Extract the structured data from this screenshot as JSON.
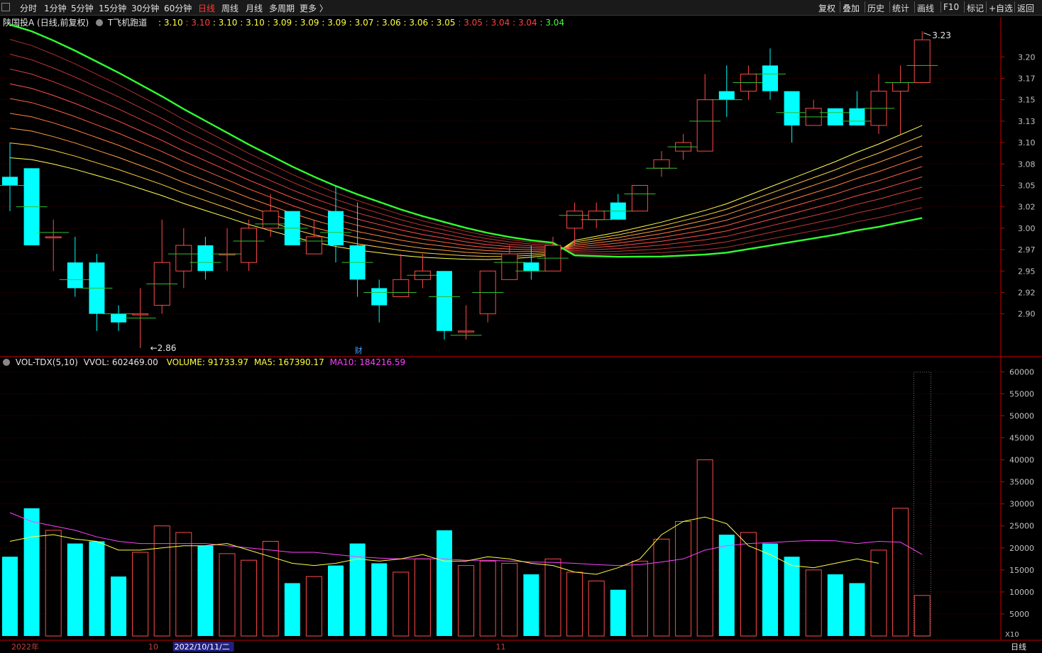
{
  "toolbar": {
    "left": [
      "分时",
      "1分钟",
      "5分钟",
      "15分钟",
      "30分钟",
      "60分钟",
      "日线",
      "周线",
      "月线",
      "多周期",
      "更多 〉"
    ],
    "active": "日线",
    "right": [
      "复权",
      "叠加",
      "历史",
      "统计",
      "画线",
      "F10",
      "标记",
      "+自选",
      "返回"
    ]
  },
  "main_info": {
    "stock": "陕国投A (日线,前复权)",
    "indicator": "T飞机跑道",
    "values": [
      {
        "v": "3.10",
        "c": "#ffff40"
      },
      {
        "v": "3.10",
        "c": "#ff4040"
      },
      {
        "v": "3.10",
        "c": "#ffff40"
      },
      {
        "v": "3.10",
        "c": "#ffff40"
      },
      {
        "v": "3.09",
        "c": "#ffff40"
      },
      {
        "v": "3.09",
        "c": "#ffff40"
      },
      {
        "v": "3.09",
        "c": "#ffff40"
      },
      {
        "v": "3.07",
        "c": "#ffff40"
      },
      {
        "v": "3.06",
        "c": "#ffff40"
      },
      {
        "v": "3.06",
        "c": "#ffff40"
      },
      {
        "v": "3.05",
        "c": "#ffff40"
      },
      {
        "v": "3.05",
        "c": "#ff4040"
      },
      {
        "v": "3.04",
        "c": "#ff4040"
      },
      {
        "v": "3.04",
        "c": "#ff4040"
      },
      {
        "v": "3.04",
        "c": "#40ff40"
      }
    ]
  },
  "vol_info": {
    "name": "VOL-TDX(5,10)",
    "vvol": "VVOL: 602469.00",
    "volume": "VOLUME: 91733.97",
    "ma5": "MA5: 167390.17",
    "ma10": "MA10: 184216.59"
  },
  "colors": {
    "up": "#ff4a4a",
    "down": "#00ffff",
    "ma5": "#ffff40",
    "ma10": "#ff40ff",
    "grid": "#5a0000",
    "axis": "#c80000"
  },
  "chart_data": {
    "type": "candlestick",
    "price_ticks": [
      "3.20",
      "3.17",
      "3.15",
      "3.13",
      "3.10",
      "3.08",
      "3.05",
      "3.02",
      "3.00",
      "2.97",
      "2.95",
      "2.92",
      "2.90"
    ],
    "price_tick_values": [
      3.2,
      3.175,
      3.15,
      3.125,
      3.1,
      3.075,
      3.05,
      3.025,
      3.0,
      2.975,
      2.95,
      2.925,
      2.9
    ],
    "price_range": [
      2.855,
      3.235
    ],
    "high_label": "3.23",
    "low_label": "2.86",
    "event_marker": "财",
    "candles": [
      {
        "o": 3.06,
        "c": 3.05,
        "h": 3.1,
        "l": 3.02
      },
      {
        "o": 3.07,
        "c": 2.98,
        "h": 3.07,
        "l": 2.98
      },
      {
        "o": 2.99,
        "c": 2.99,
        "h": 3.01,
        "l": 2.95
      },
      {
        "o": 2.96,
        "c": 2.93,
        "h": 2.99,
        "l": 2.92
      },
      {
        "o": 2.96,
        "c": 2.9,
        "h": 2.97,
        "l": 2.88
      },
      {
        "o": 2.9,
        "c": 2.89,
        "h": 2.91,
        "l": 2.88
      },
      {
        "o": 2.9,
        "c": 2.9,
        "h": 2.93,
        "l": 2.86
      },
      {
        "o": 2.91,
        "c": 2.96,
        "h": 3.01,
        "l": 2.9
      },
      {
        "o": 2.95,
        "c": 2.98,
        "h": 3.0,
        "l": 2.93
      },
      {
        "o": 2.98,
        "c": 2.95,
        "h": 2.99,
        "l": 2.94
      },
      {
        "o": 2.97,
        "c": 2.97,
        "h": 3.0,
        "l": 2.95
      },
      {
        "o": 2.96,
        "c": 3.0,
        "h": 3.01,
        "l": 2.95
      },
      {
        "o": 3.0,
        "c": 3.02,
        "h": 3.04,
        "l": 2.99
      },
      {
        "o": 3.02,
        "c": 2.98,
        "h": 3.02,
        "l": 2.98
      },
      {
        "o": 2.97,
        "c": 2.99,
        "h": 3.01,
        "l": 2.97
      },
      {
        "o": 3.02,
        "c": 2.98,
        "h": 3.05,
        "l": 2.96
      },
      {
        "o": 2.98,
        "c": 2.94,
        "h": 3.03,
        "l": 2.92
      },
      {
        "o": 2.93,
        "c": 2.91,
        "h": 2.94,
        "l": 2.89
      },
      {
        "o": 2.92,
        "c": 2.94,
        "h": 2.97,
        "l": 2.92
      },
      {
        "o": 2.94,
        "c": 2.95,
        "h": 2.97,
        "l": 2.93
      },
      {
        "o": 2.95,
        "c": 2.88,
        "h": 2.95,
        "l": 2.87
      },
      {
        "o": 2.88,
        "c": 2.88,
        "h": 2.91,
        "l": 2.87
      },
      {
        "o": 2.9,
        "c": 2.95,
        "h": 2.95,
        "l": 2.89
      },
      {
        "o": 2.94,
        "c": 2.97,
        "h": 2.98,
        "l": 2.94
      },
      {
        "o": 2.96,
        "c": 2.95,
        "h": 2.98,
        "l": 2.94
      },
      {
        "o": 2.95,
        "c": 2.98,
        "h": 2.99,
        "l": 2.95
      },
      {
        "o": 3.0,
        "c": 3.02,
        "h": 3.03,
        "l": 2.98
      },
      {
        "o": 3.01,
        "c": 3.02,
        "h": 3.03,
        "l": 3.0
      },
      {
        "o": 3.03,
        "c": 3.01,
        "h": 3.04,
        "l": 3.01
      },
      {
        "o": 3.02,
        "c": 3.05,
        "h": 3.05,
        "l": 3.02
      },
      {
        "o": 3.07,
        "c": 3.08,
        "h": 3.09,
        "l": 3.06
      },
      {
        "o": 3.09,
        "c": 3.1,
        "h": 3.11,
        "l": 3.08
      },
      {
        "o": 3.09,
        "c": 3.15,
        "h": 3.18,
        "l": 3.09
      },
      {
        "o": 3.16,
        "c": 3.15,
        "h": 3.19,
        "l": 3.13
      },
      {
        "o": 3.16,
        "c": 3.18,
        "h": 3.19,
        "l": 3.15
      },
      {
        "o": 3.19,
        "c": 3.16,
        "h": 3.21,
        "l": 3.15
      },
      {
        "o": 3.16,
        "c": 3.12,
        "h": 3.16,
        "l": 3.1
      },
      {
        "o": 3.12,
        "c": 3.14,
        "h": 3.15,
        "l": 3.12
      },
      {
        "o": 3.14,
        "c": 3.12,
        "h": 3.14,
        "l": 3.12
      },
      {
        "o": 3.14,
        "c": 3.12,
        "h": 3.16,
        "l": 3.12
      },
      {
        "o": 3.12,
        "c": 3.16,
        "h": 3.18,
        "l": 3.11
      },
      {
        "o": 3.16,
        "c": 3.17,
        "h": 3.19,
        "l": 3.11
      },
      {
        "o": 3.17,
        "c": 3.22,
        "h": 3.23,
        "l": 3.17
      }
    ],
    "ribbon_mid": [
      3.16,
      3.155,
      3.147,
      3.138,
      3.128,
      3.118,
      3.107,
      3.096,
      3.084,
      3.073,
      3.062,
      3.051,
      3.041,
      3.031,
      3.022,
      3.014,
      3.007,
      3.001,
      2.995,
      2.99,
      2.986,
      2.982,
      2.979,
      2.977,
      2.976,
      2.976,
      2.977,
      2.979,
      2.981,
      2.984,
      2.987,
      2.991,
      2.995,
      3.0,
      3.007,
      3.014,
      3.021,
      3.028,
      3.035,
      3.043,
      3.05,
      3.058,
      3.066
    ],
    "vol_ticks": [
      "60000",
      "55000",
      "50000",
      "45000",
      "40000",
      "35000",
      "30000",
      "25000",
      "20000",
      "15000",
      "10000",
      "5000"
    ],
    "vol_tick_values": [
      60000,
      55000,
      50000,
      45000,
      40000,
      35000,
      30000,
      25000,
      20000,
      15000,
      10000,
      5000
    ],
    "vol_range": [
      0,
      61500
    ],
    "vol_unit": "X10",
    "volumes": [
      18000,
      29000,
      24000,
      21000,
      21500,
      13500,
      19000,
      25000,
      23500,
      20500,
      18700,
      17200,
      21500,
      12000,
      13500,
      16000,
      21000,
      16500,
      14500,
      17500,
      24000,
      16000,
      17000,
      16500,
      14000,
      17500,
      14500,
      12500,
      10500,
      17000,
      22000,
      26000,
      40000,
      23000,
      23500,
      21000,
      18000,
      15000,
      14000,
      12000,
      19500,
      29000,
      9200
    ],
    "ma5": [
      21500,
      22500,
      23000,
      22000,
      21500,
      19500,
      19500,
      20000,
      20500,
      20500,
      21000,
      19500,
      18000,
      16500,
      16000,
      16500,
      17500,
      17000,
      17500,
      18500,
      17000,
      17000,
      18000,
      17500,
      16500,
      16000,
      14500,
      14000,
      15500,
      17500,
      23000,
      26000,
      27000,
      25500,
      20500,
      18500,
      16000,
      15500,
      16500,
      17500,
      16500
    ],
    "ma10": [
      28000,
      26000,
      25000,
      24000,
      22500,
      21500,
      21000,
      21000,
      21000,
      21000,
      20500,
      20000,
      19500,
      19000,
      19000,
      18500,
      18000,
      17700,
      17500,
      17500,
      17500,
      17200,
      17200,
      17000,
      16800,
      16700,
      16500,
      16200,
      16000,
      16200,
      16800,
      17500,
      19500,
      20500,
      21000,
      21200,
      21500,
      21700,
      21600,
      21000,
      21500,
      21300,
      18500
    ],
    "x_labels": [
      {
        "text": "2022年",
        "at": 0
      },
      {
        "text": "10",
        "at": 6.5
      },
      {
        "text": "2022/10/11/二",
        "at": 7.7
      },
      {
        "text": "11",
        "at": 22.5
      }
    ],
    "period_label": "日线"
  }
}
